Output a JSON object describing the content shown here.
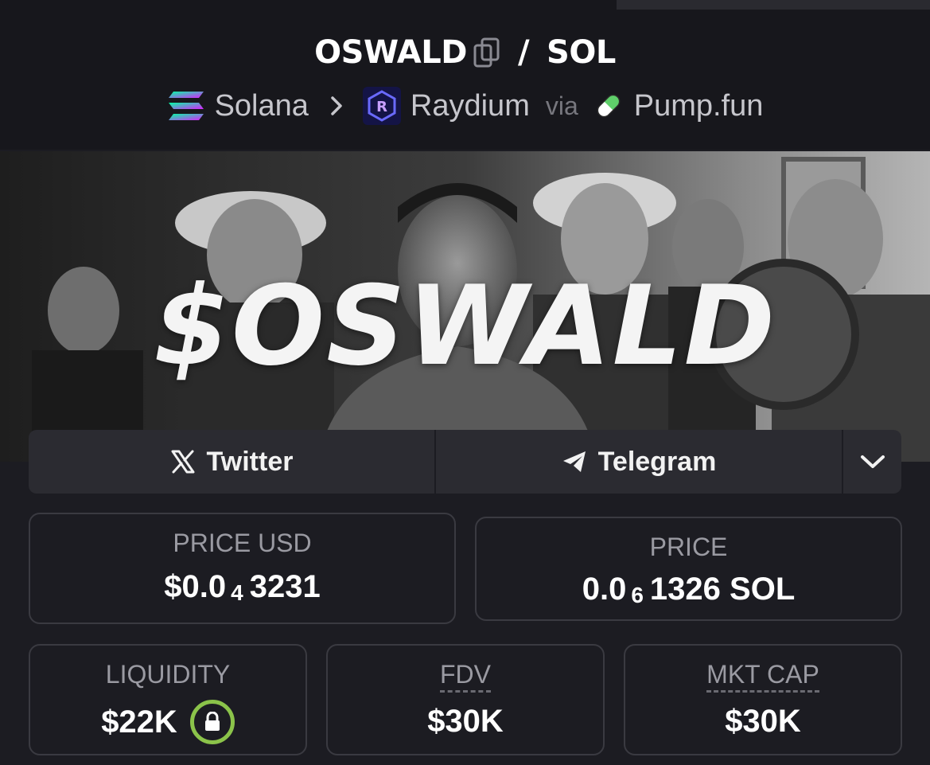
{
  "pair": {
    "base": "OSWALD",
    "slash": "/",
    "quote": "SOL"
  },
  "breadcrumb": {
    "chain": "Solana",
    "dex": "Raydium",
    "via": "via",
    "launchpad": "Pump.fun"
  },
  "banner": {
    "text": "$OSWALD"
  },
  "socials": {
    "twitter": "Twitter",
    "telegram": "Telegram"
  },
  "stats": {
    "price_usd": {
      "label": "PRICE USD",
      "prefix": "$0.0",
      "zeros": "4",
      "digits": "3231"
    },
    "price_native": {
      "label": "PRICE",
      "prefix": "0.0",
      "zeros": "6",
      "digits": "1326 SOL"
    },
    "liquidity": {
      "label": "LIQUIDITY",
      "value": "$22K"
    },
    "fdv": {
      "label": "FDV",
      "value": "$30K"
    },
    "mkt_cap": {
      "label": "MKT CAP",
      "value": "$30K"
    }
  },
  "icons": {
    "copy": "copy-icon",
    "chevron_right": "chevron-right-icon",
    "solana": "solana-logo-icon",
    "raydium": "raydium-logo-icon",
    "pill": "pill-icon",
    "x": "x-logo-icon",
    "telegram": "telegram-icon",
    "chevron_down": "chevron-down-icon",
    "lock": "lock-icon"
  },
  "colors": {
    "background": "#1c1c22",
    "header": "#17171c",
    "card_border": "#3a3a41",
    "lock_ring": "#8bc34a"
  }
}
